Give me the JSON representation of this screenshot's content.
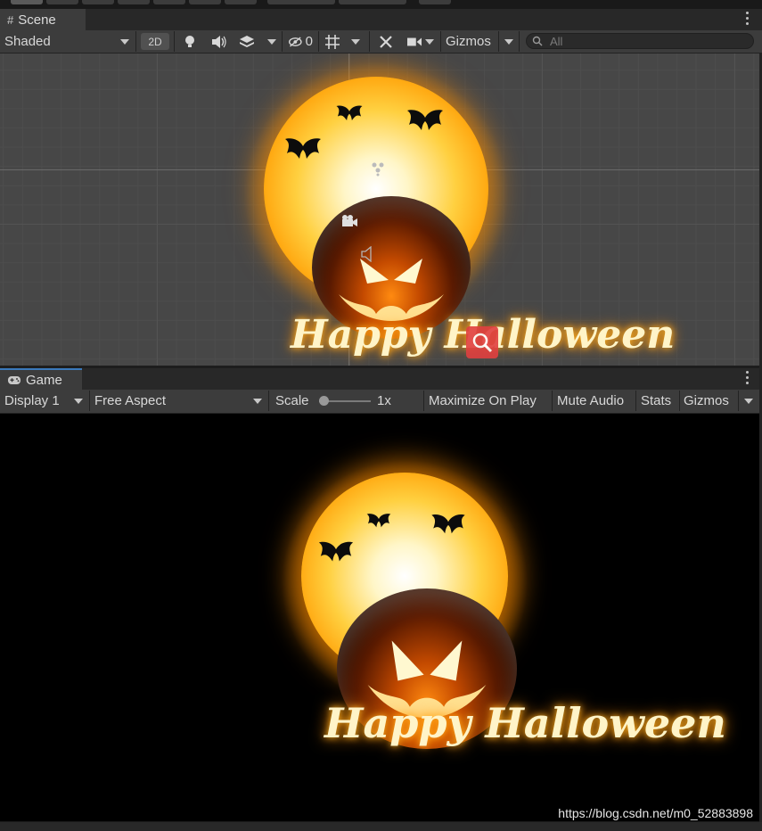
{
  "scene_panel": {
    "tab_label": "Scene",
    "shading_mode": "Shaded",
    "mode_2d_label": "2D",
    "hidden_count": "0",
    "gizmos_label": "Gizmos",
    "search_placeholder": "All"
  },
  "game_panel": {
    "tab_label": "Game",
    "display_label": "Display 1",
    "aspect_label": "Free Aspect",
    "scale_label": "Scale",
    "scale_value": "1x",
    "scale_fraction": 0.0,
    "maximize_label": "Maximize On Play",
    "mute_label": "Mute Audio",
    "stats_label": "Stats",
    "gizmos_label": "Gizmos"
  },
  "artwork": {
    "title_text": "Happy Halloween"
  },
  "watermark": "https://blog.csdn.net/m0_52883898",
  "colors": {
    "panel_bg": "#3c3c3c",
    "scene_grid_bg": "#474747",
    "game_bg": "#000000",
    "active_tab_accent": "#3a79bb",
    "sun_orange": "#ff9a00"
  }
}
